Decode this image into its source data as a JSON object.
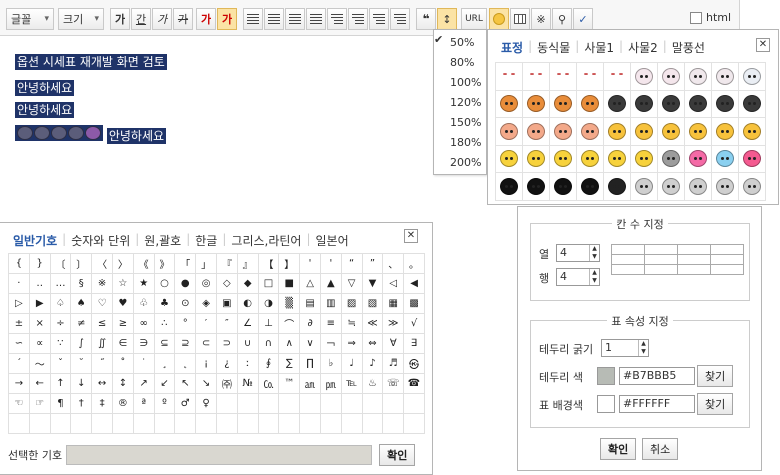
{
  "toolbar": {
    "font_label": "글꼴",
    "size_label": "크기",
    "bold": "가",
    "underline": "간",
    "italic": "가",
    "strike": "가",
    "font_color": "가",
    "bg_color": "가",
    "url_label": "URL",
    "html_label": "html",
    "html_checked": false
  },
  "editor": {
    "lines": [
      "옵션 시세표 재개발 화면 검토",
      "안녕하세요",
      "안녕하세요"
    ],
    "last_line_text": "안녕하세요"
  },
  "zoom_menu": {
    "items": [
      {
        "label": "50%",
        "checked": false
      },
      {
        "label": "80%",
        "checked": false
      },
      {
        "label": "100%",
        "checked": false
      },
      {
        "label": "120%",
        "checked": false
      },
      {
        "label": "150%",
        "checked": false
      },
      {
        "label": "180%",
        "checked": false
      },
      {
        "label": "200%",
        "checked": true
      }
    ],
    "check_mark": "✔"
  },
  "emoticon_panel": {
    "tabs": [
      "표정",
      "동식물",
      "사물1",
      "사물2",
      "말풍선"
    ],
    "active_tab": "표정",
    "close_label": "✕",
    "rows": [
      [
        "#ffffff",
        "#ffffff",
        "#ffffff",
        "#ffffff",
        "#ffffff",
        "#f4e6ec",
        "#f4e6ec",
        "#f0e8ec",
        "#f0e8ec",
        "#eaeef4"
      ],
      [
        "#e98d3a",
        "#e98d3a",
        "#e98d3a",
        "#e98d3a",
        "#3a3a3a",
        "#3a3a3a",
        "#3a3a3a",
        "#3a3a3a",
        "#3a3a3a",
        "#3a3a3a"
      ],
      [
        "#f3a98a",
        "#f3a98a",
        "#f3a98a",
        "#f3a98a",
        "#f7c23c",
        "#f7c23c",
        "#f7c23c",
        "#f7c23c",
        "#f7c23c",
        "#f7c23c"
      ],
      [
        "#f7d23c",
        "#f7d23c",
        "#f7d23c",
        "#f7d23c",
        "#f7d23c",
        "#f7d23c",
        "#9c9c9c",
        "#f46aa6",
        "#8ad0f0",
        "#f45a90"
      ],
      [
        "#111111",
        "#111111",
        "#111111",
        "#111111",
        "#222222",
        "#cfcfcf",
        "#cfcfcf",
        "#cfcfcf",
        "#cfcfcf",
        "#cfcfcf"
      ]
    ],
    "first_row_text": true
  },
  "symbol_panel": {
    "tabs": [
      "일반기호",
      "숫자와 단위",
      "원,괄호",
      "한글",
      "그리스,라틴어",
      "일본어"
    ],
    "active_tab": "일반기호",
    "close_label": "✕",
    "symbols": [
      [
        "{",
        "}",
        "〔",
        "〕",
        "〈",
        "〉",
        "《",
        "》",
        "「",
        "」",
        "『",
        "』",
        "【",
        "】",
        "'",
        "'",
        "“",
        "”",
        "、",
        "。"
      ],
      [
        "·",
        "‥",
        "…",
        "§",
        "※",
        "☆",
        "★",
        "○",
        "●",
        "◎",
        "◇",
        "◆",
        "□",
        "■",
        "△",
        "▲",
        "▽",
        "▼",
        "◁",
        "◀"
      ],
      [
        "▷",
        "▶",
        "♤",
        "♠",
        "♡",
        "♥",
        "♧",
        "♣",
        "⊙",
        "◈",
        "▣",
        "◐",
        "◑",
        "▒",
        "▤",
        "▥",
        "▨",
        "▧",
        "▦",
        "▩"
      ],
      [
        "±",
        "×",
        "÷",
        "≠",
        "≤",
        "≥",
        "∞",
        "∴",
        "°",
        "′",
        "″",
        "∠",
        "⊥",
        "⌒",
        "∂",
        "≡",
        "≒",
        "≪",
        "≫",
        "√"
      ],
      [
        "∽",
        "∝",
        "∵",
        "∫",
        "∬",
        "∈",
        "∋",
        "⊆",
        "⊇",
        "⊂",
        "⊃",
        "∪",
        "∩",
        "∧",
        "∨",
        "￢",
        "⇒",
        "⇔",
        "∀",
        "∃"
      ],
      [
        "´",
        "～",
        "ˇ",
        "˘",
        "˝",
        "˚",
        "˙",
        "¸",
        "˛",
        "¡",
        "¿",
        "ː",
        "∮",
        "∑",
        "∏",
        "♭",
        "♩",
        "♪",
        "♬",
        "㉿"
      ],
      [
        "→",
        "←",
        "↑",
        "↓",
        "↔",
        "↕",
        "↗",
        "↙",
        "↖",
        "↘",
        "㈜",
        "№",
        "㏇",
        "™",
        "㏂",
        "㏘",
        "℡",
        "♨",
        "☏",
        "☎"
      ],
      [
        "☜",
        "☞",
        "¶",
        "†",
        "‡",
        "®",
        "ª",
        "º",
        "♂",
        "♀",
        "",
        "",
        "",
        "",
        "",
        "",
        "",
        "",
        "",
        ""
      ],
      [
        "",
        "",
        "",
        "",
        "",
        "",
        "",
        "",
        "",
        "",
        "",
        "",
        "",
        "",
        "",
        "",
        "",
        "",
        "",
        ""
      ]
    ],
    "selected_label": "선택한 기호",
    "selected_value": "",
    "confirm_label": "확인"
  },
  "table_panel": {
    "section1_title": "칸 수 지정",
    "cols_label": "열",
    "cols_value": "4",
    "rows_label": "행",
    "rows_value": "4",
    "section2_title": "표 속성 지정",
    "border_width_label": "테두리 굵기",
    "border_width_value": "1",
    "border_color_label": "테두리 색",
    "border_color_value": "#B7BBB5",
    "bg_color_label": "표 배경색",
    "bg_color_value": "#FFFFFF",
    "find_label": "찾기",
    "confirm_label": "확인",
    "cancel_label": "취소"
  }
}
